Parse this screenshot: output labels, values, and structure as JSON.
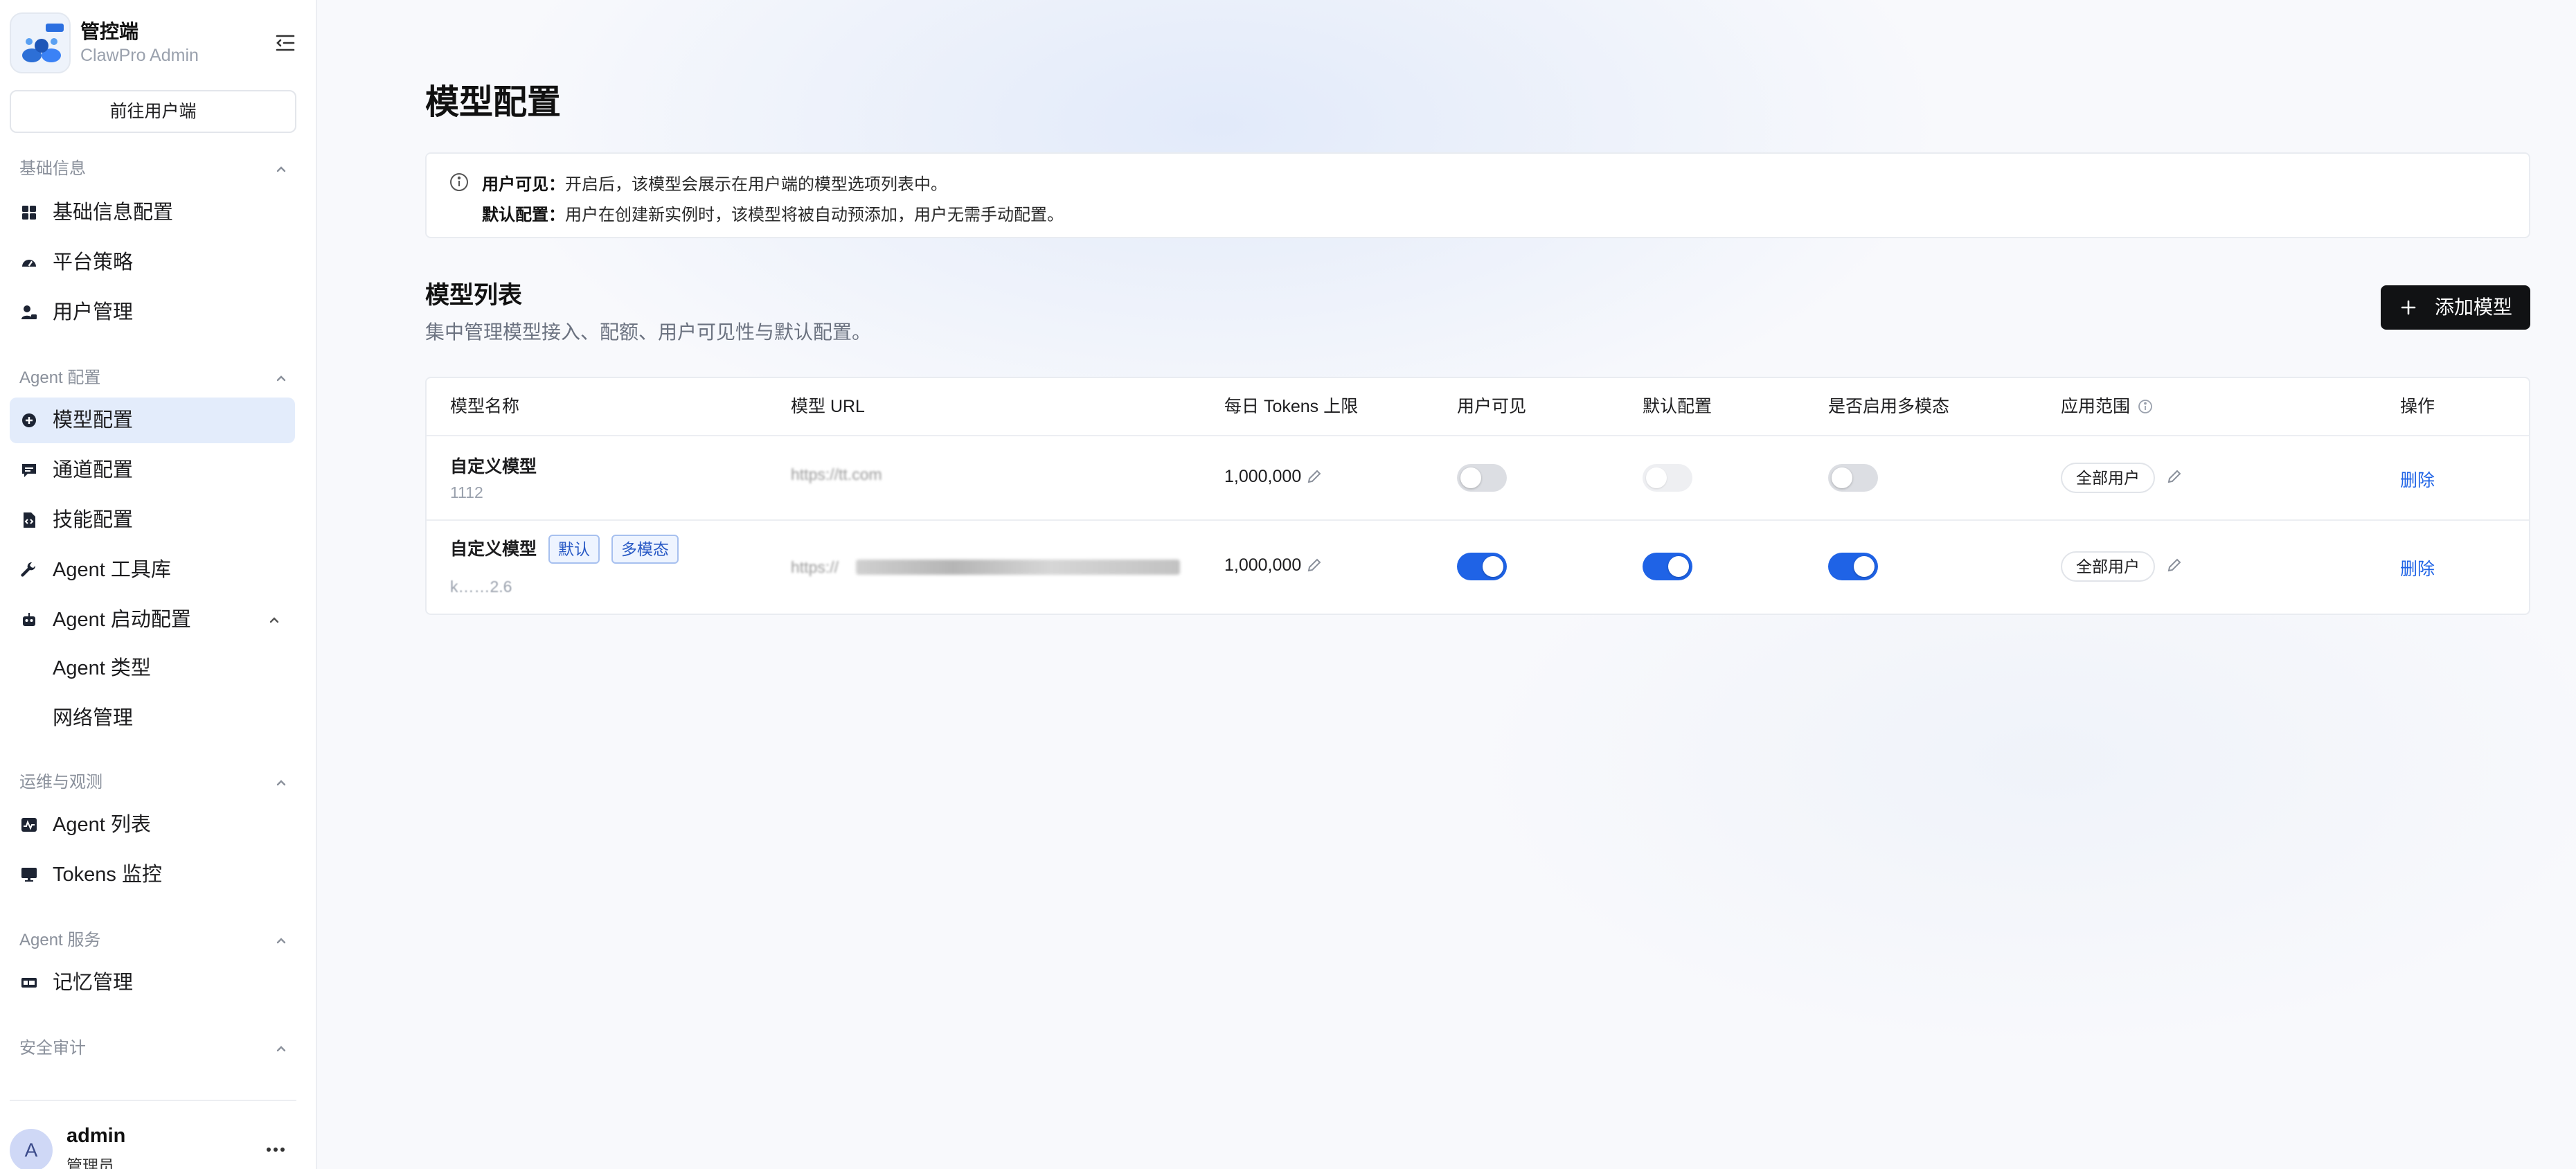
{
  "brand": {
    "title": "管控端",
    "subtitle": "ClawPro Admin"
  },
  "sidebar": {
    "goto_user_label": "前往用户端",
    "sections": [
      {
        "title": "基础信息",
        "items": [
          {
            "label": "基础信息配置",
            "icon": "grid-icon"
          },
          {
            "label": "平台策略",
            "icon": "gauge-icon"
          },
          {
            "label": "用户管理",
            "icon": "user-lock-icon"
          }
        ]
      },
      {
        "title": "Agent 配置",
        "items": [
          {
            "label": "模型配置",
            "icon": "model-icon",
            "active": true
          },
          {
            "label": "通道配置",
            "icon": "message-icon"
          },
          {
            "label": "技能配置",
            "icon": "file-code-icon"
          },
          {
            "label": "Agent 工具库",
            "icon": "wrench-icon"
          },
          {
            "label": "Agent 启动配置",
            "icon": "robot-icon",
            "expanded": true,
            "children": [
              {
                "label": "Agent 类型"
              },
              {
                "label": "网络管理"
              }
            ]
          }
        ]
      },
      {
        "title": "运维与观测",
        "items": [
          {
            "label": "Agent 列表",
            "icon": "activity-icon"
          },
          {
            "label": "Tokens 监控",
            "icon": "monitor-icon"
          }
        ]
      },
      {
        "title": "Agent 服务",
        "items": [
          {
            "label": "记忆管理",
            "icon": "memory-icon"
          }
        ]
      },
      {
        "title": "安全审计",
        "items": []
      }
    ],
    "user": {
      "avatar_letter": "A",
      "name": "admin",
      "role": "管理员"
    }
  },
  "main": {
    "page_title": "模型配置",
    "info": {
      "line1_key": "用户可见：",
      "line1_text": "开启后，该模型会展示在用户端的模型选项列表中。",
      "line2_key": "默认配置：",
      "line2_text": "用户在创建新实例时，该模型将被自动预添加，用户无需手动配置。"
    },
    "list_title": "模型列表",
    "list_subtitle": "集中管理模型接入、配额、用户可见性与默认配置。",
    "add_button_label": "添加模型",
    "table": {
      "columns": [
        "模型名称",
        "模型 URL",
        "每日 Tokens 上限",
        "用户可见",
        "默认配置",
        "是否启用多模态",
        "应用范围",
        "操作"
      ],
      "rows": [
        {
          "name": "自定义模型",
          "model_id": "1112",
          "tags": [],
          "url": "https://tt.com",
          "daily_tokens": "1,000,000",
          "user_visible": false,
          "default_config": false,
          "default_config_disabled": true,
          "multimodal": false,
          "scope": "全部用户",
          "action": "删除"
        },
        {
          "name": "自定义模型",
          "model_id": "k……2.6",
          "tags": [
            "默认",
            "多模态"
          ],
          "url": "https://",
          "daily_tokens": "1,000,000",
          "user_visible": true,
          "default_config": true,
          "multimodal": true,
          "scope": "全部用户",
          "action": "删除"
        }
      ]
    }
  },
  "colors": {
    "primary": "#1f63e6",
    "active_nav_bg": "#e3ecfb",
    "dark_button": "#111214"
  }
}
